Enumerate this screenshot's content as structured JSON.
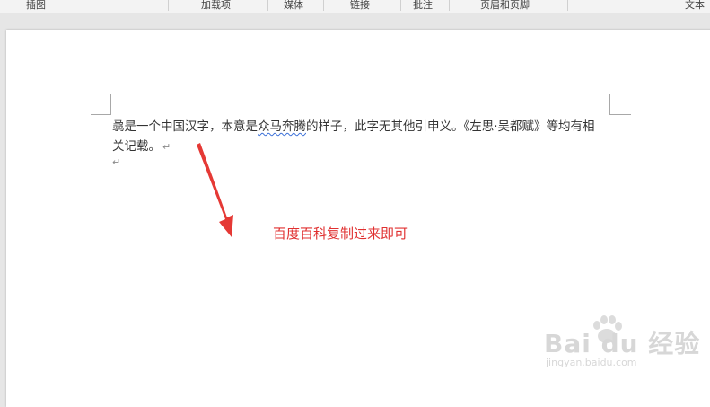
{
  "ribbon": {
    "groups": [
      "插图",
      "加载项",
      "媒体",
      "链接",
      "批注",
      "页眉和页脚",
      "文本"
    ]
  },
  "document": {
    "line1_part1": "骉是一个中国汉字，本意是",
    "line1_underlined": "众马奔腾",
    "line1_part2": "的样子，此字无其他引申义。《左思·吴都赋》等均有相",
    "line2": "关记载。",
    "paragraph_mark": "↵"
  },
  "annotation": {
    "text": "百度百科复制过来即可",
    "color": "#e03030"
  },
  "watermark": {
    "logo": "Bai du 经验",
    "url": "jingyan.baidu.com"
  },
  "colors": {
    "arrow": "#e53935",
    "spell_underline": "#3a6fd8"
  }
}
